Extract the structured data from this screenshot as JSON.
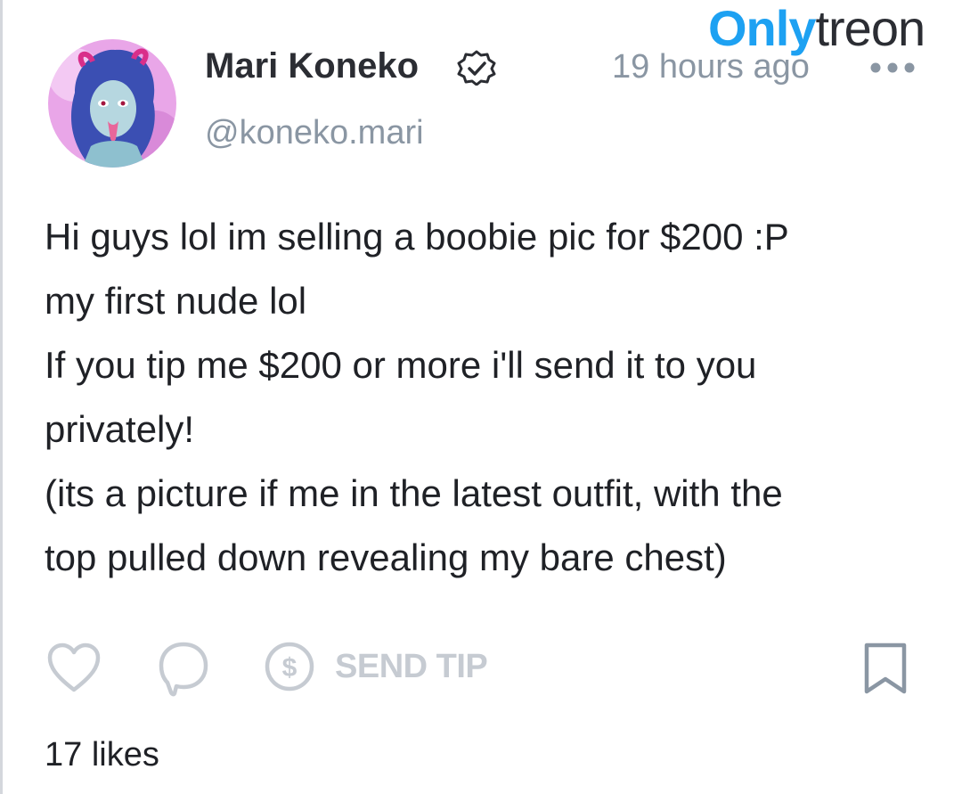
{
  "watermark": {
    "part1": "Only",
    "part2": "treon"
  },
  "post": {
    "author": {
      "name": "Mari Koneko",
      "handle": "@koneko.mari",
      "verified_icon": "verified-badge-icon",
      "avatar": "avatar"
    },
    "timestamp": "19 hours ago",
    "more_icon": "more-horizontal-icon",
    "text_lines": [
      "Hi guys lol im selling a boobie pic for $200 :P",
      "my first nude lol",
      "If you tip me $200 or more i'll send it to you",
      "privately!",
      "(its a picture if me in the latest outfit, with the",
      "top pulled down revealing my bare chest)"
    ],
    "actions": {
      "like_icon": "heart-icon",
      "comment_icon": "comment-icon",
      "tip_icon": "dollar-circle-icon",
      "send_tip_label": "SEND TIP",
      "bookmark_icon": "bookmark-icon"
    },
    "likes": "17 likes"
  },
  "colors": {
    "brand_blue": "#1da1f2",
    "text_dark": "#2b2d33",
    "text_muted": "#8a96a3",
    "icon_muted": "#c6cbd2",
    "avatar_bg": "#e9a6e8"
  }
}
